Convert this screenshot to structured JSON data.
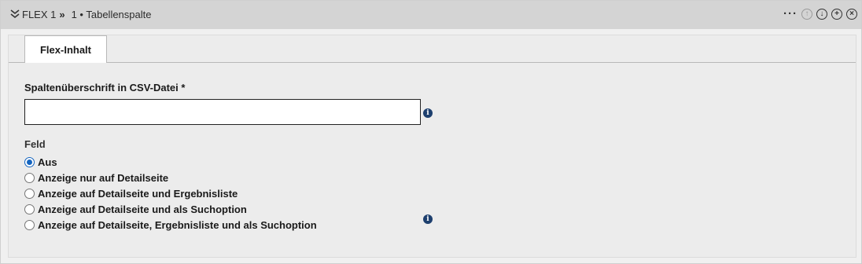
{
  "header": {
    "breadcrumb_root": "FLEX 1",
    "breadcrumb_sep": "»",
    "breadcrumb_current": "1 • Tabellenspalte",
    "more_label": "···",
    "icons": [
      "collapse-icon",
      "move-up-icon",
      "move-down-icon",
      "add-icon",
      "close-icon"
    ]
  },
  "tabs": [
    {
      "label": "Flex-Inhalt"
    }
  ],
  "form": {
    "column_header_label": "Spaltenüberschrift in CSV-Datei *",
    "column_header_value": "",
    "feld_label": "Feld",
    "radio_options": [
      {
        "label": "Aus",
        "checked": true
      },
      {
        "label": "Anzeige nur auf Detailseite",
        "checked": false
      },
      {
        "label": "Anzeige auf Detailseite und Ergebnisliste",
        "checked": false
      },
      {
        "label": "Anzeige auf Detailseite und als Suchoption",
        "checked": false
      },
      {
        "label": "Anzeige auf Detailseite, Ergebnisliste und als Suchoption",
        "checked": false
      }
    ]
  },
  "colors": {
    "header_bg": "#d4d4d4",
    "panel_bg": "#ececec",
    "info_icon": "#1d3f6e",
    "radio_accent": "#1565c0"
  }
}
